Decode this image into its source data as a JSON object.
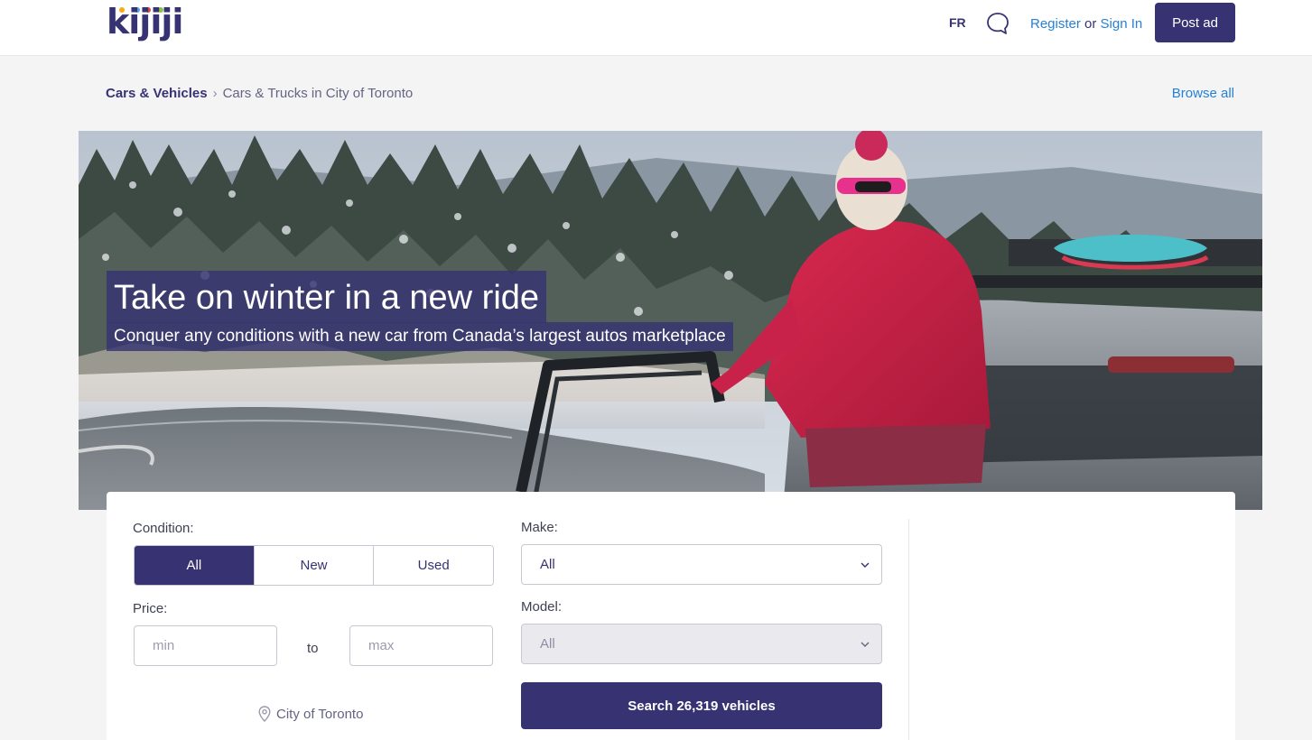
{
  "header": {
    "logo": "kijiji",
    "language_toggle": "FR",
    "register_label": "Register",
    "or_label": "or",
    "sign_in_label": "Sign In",
    "post_ad_label": "Post ad"
  },
  "breadcrumb": {
    "root": "Cars & Vehicles",
    "separator": "›",
    "current": "Cars & Trucks in City of Toronto"
  },
  "browse_all_label": "Browse all",
  "hero": {
    "title": "Take on winter in a new ride",
    "subtitle": "Conquer any conditions with a new car from Canada’s largest autos marketplace"
  },
  "search_form": {
    "condition_label": "Condition:",
    "condition_options": [
      "All",
      "New",
      "Used"
    ],
    "condition_selected": "All",
    "price_label": "Price:",
    "price_min_placeholder": "min",
    "price_to_label": "to",
    "price_max_placeholder": "max",
    "location": "City of Toronto",
    "make_label": "Make:",
    "make_value": "All",
    "model_label": "Model:",
    "model_value": "All",
    "search_button_label": "Search 26,319 vehicles"
  },
  "colors": {
    "brand": "#373373",
    "link": "#2680d5",
    "page_bg": "#f4f4f5"
  }
}
